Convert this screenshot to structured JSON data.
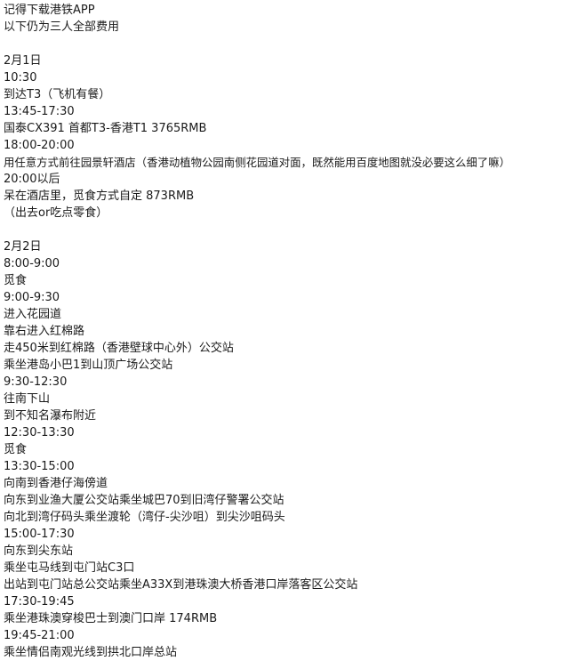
{
  "lines": [
    "记得下载港铁APP",
    "以下仍为三人全部费用",
    "",
    "2月1日",
    "10:30",
    "到达T3（飞机有餐）",
    "13:45-17:30",
    "国泰CX391 首都T3-香港T1 3765RMB",
    "18:00-20:00",
    "用任意方式前往园景轩酒店（香港动植物公园南侧花园道对面，既然能用百度地图就没必要这么细了嘛）",
    "20:00以后",
    "呆在酒店里，觅食方式自定 873RMB",
    "（出去or吃点零食）",
    "",
    "2月2日",
    "8:00-9:00",
    "觅食",
    "9:00-9:30",
    "进入花园道",
    "靠右进入红棉路",
    "走450米到红棉路（香港壁球中心外）公交站",
    "乘坐港岛小巴1到山顶广场公交站",
    "9:30-12:30",
    "往南下山",
    "到不知名瀑布附近",
    "12:30-13:30",
    "觅食",
    "13:30-15:00",
    "向南到香港仔海傍道",
    "向东到业渔大厦公交站乘坐城巴70到旧湾仔警署公交站",
    "向北到湾仔码头乘坐渡轮（湾仔-尖沙咀）到尖沙咀码头",
    "15:00-17:30",
    "向东到尖东站",
    "乘坐屯马线到屯门站C3口",
    "出站到屯门站总公交站乘坐A33X到港珠澳大桥香港口岸落客区公交站",
    "17:30-19:45",
    "乘坐港珠澳穿梭巴士到澳门口岸 174RMB",
    "19:45-21:00",
    "乘坐情侣南观光线到拱北口岸总站"
  ]
}
